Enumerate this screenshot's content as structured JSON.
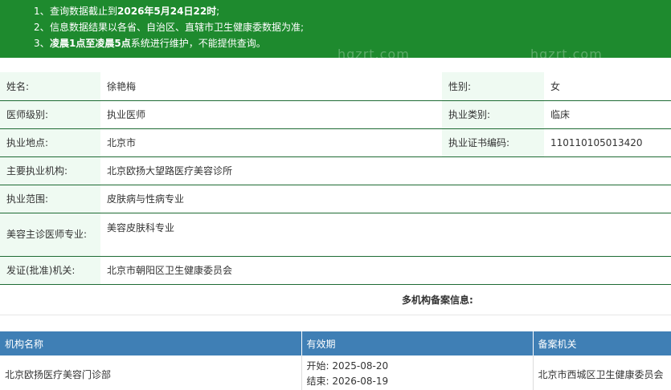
{
  "notice": {
    "lines": [
      {
        "num": "1、",
        "text": "查询数据截止到",
        "bold": "2026年5月24日22时",
        "tail": ";"
      },
      {
        "num": "2、",
        "text": "信息数据结果以各省、自治区、直辖市卫生健康委数据为准;",
        "bold": "",
        "tail": ""
      },
      {
        "num": "3、",
        "text": "",
        "bold": "凌晨1点至凌晨5点",
        "tail": "系统进行维护，不能提供查询。"
      }
    ],
    "watermark": "hgzrt.com"
  },
  "doctor": {
    "name_label": "姓名:",
    "name": "徐艳梅",
    "gender_label": "性别:",
    "gender": "女",
    "level_label": "医师级别:",
    "level": "执业医师",
    "category_label": "执业类别:",
    "category": "临床",
    "location_label": "执业地点:",
    "location": "北京市",
    "cert_label": "执业证书编码:",
    "cert": "110110105013420",
    "org_label": "主要执业机构:",
    "org": "北京欧扬大望路医疗美容诊所",
    "scope_label": "执业范围:",
    "scope": "皮肤病与性病专业",
    "cosmetic_label": "美容主诊医师专业:",
    "cosmetic": "美容皮肤科专业",
    "issuer_label": "发证(批准)机关:",
    "issuer": "北京市朝阳区卫生健康委员会"
  },
  "multi": {
    "title": "多机构备案信息:",
    "headers": {
      "org": "机构名称",
      "valid": "有效期",
      "authority": "备案机关"
    },
    "rows": [
      {
        "org": "北京欧扬医疗美容门诊部",
        "start": "开始:  2025-08-20",
        "end": "结束:  2026-08-19",
        "authority": "北京市西城区卫生健康委员会"
      }
    ]
  }
}
